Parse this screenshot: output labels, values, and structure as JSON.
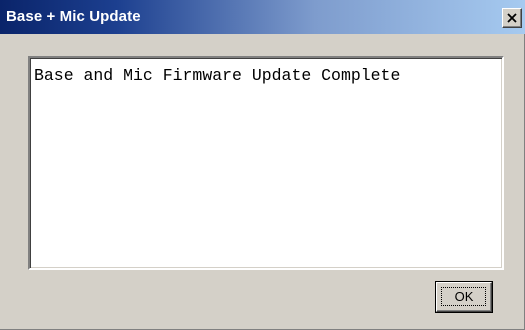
{
  "dialog": {
    "title": "Base + Mic Update",
    "message": "Base and Mic Firmware Update Complete",
    "ok_label": "OK",
    "close_icon": "close-icon"
  },
  "colors": {
    "titlebar_start": "#0a246a",
    "titlebar_end": "#a6caf0",
    "window_bg": "#d4d0c8",
    "text_area_bg": "#ffffff"
  }
}
